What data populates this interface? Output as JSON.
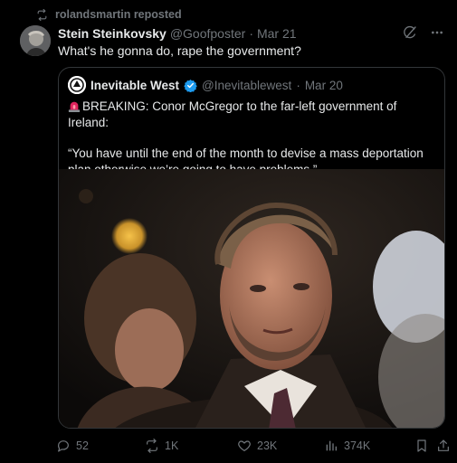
{
  "repost": {
    "text": "rolandsmartin reposted"
  },
  "tweet": {
    "author_name": "Stein Steinkovsky",
    "handle": "@Goofposter",
    "separator": "·",
    "date": "Mar 21",
    "text": "What's he gonna do, rape the government?"
  },
  "quote": {
    "author_name": "Inevitable West",
    "handle": "@Inevitablewest",
    "separator": "·",
    "date": "Mar 20",
    "headline": "BREAKING: Conor McGregor to the far-left government of Ireland:",
    "quote_text": "“You have until the end of the month to devise a mass deportation plan otherwise we’re going to have problems.”"
  },
  "actions": {
    "replies": "52",
    "reposts": "1K",
    "likes": "23K",
    "views": "374K"
  },
  "colors": {
    "background": "#000000",
    "text": "#e7e9ea",
    "muted": "#71767b",
    "border": "#333639",
    "verified": "#1d9bf0",
    "siren": "#e0245e"
  },
  "icons": [
    "repost-icon",
    "grok-icon",
    "more-icon",
    "verified-badge-icon",
    "siren-emoji-icon",
    "reply-icon",
    "like-icon",
    "views-icon",
    "bookmark-icon",
    "share-icon"
  ]
}
